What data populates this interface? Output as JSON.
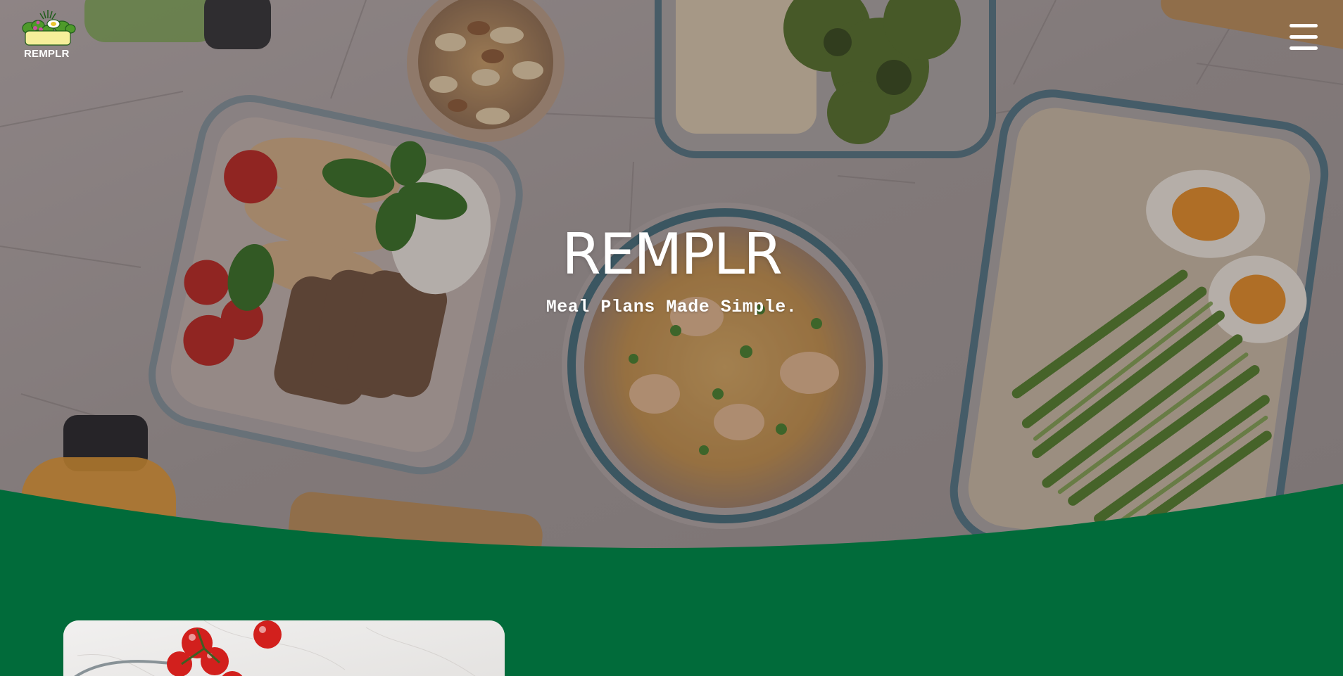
{
  "brand": {
    "name": "REMPLR",
    "logo_icon": "salad-bowl-icon"
  },
  "header": {
    "menu_icon": "hamburger-menu-icon"
  },
  "hero": {
    "title": "REMPLR",
    "subtitle": "Meal Plans Made Simple.",
    "image": "meal-prep-containers-photo"
  },
  "card": {
    "image": "cherry-tomatoes-photo"
  },
  "colors": {
    "brand_green": "#016b3a",
    "logo_yellow": "#f6ef9a",
    "text_white": "#ffffff"
  }
}
